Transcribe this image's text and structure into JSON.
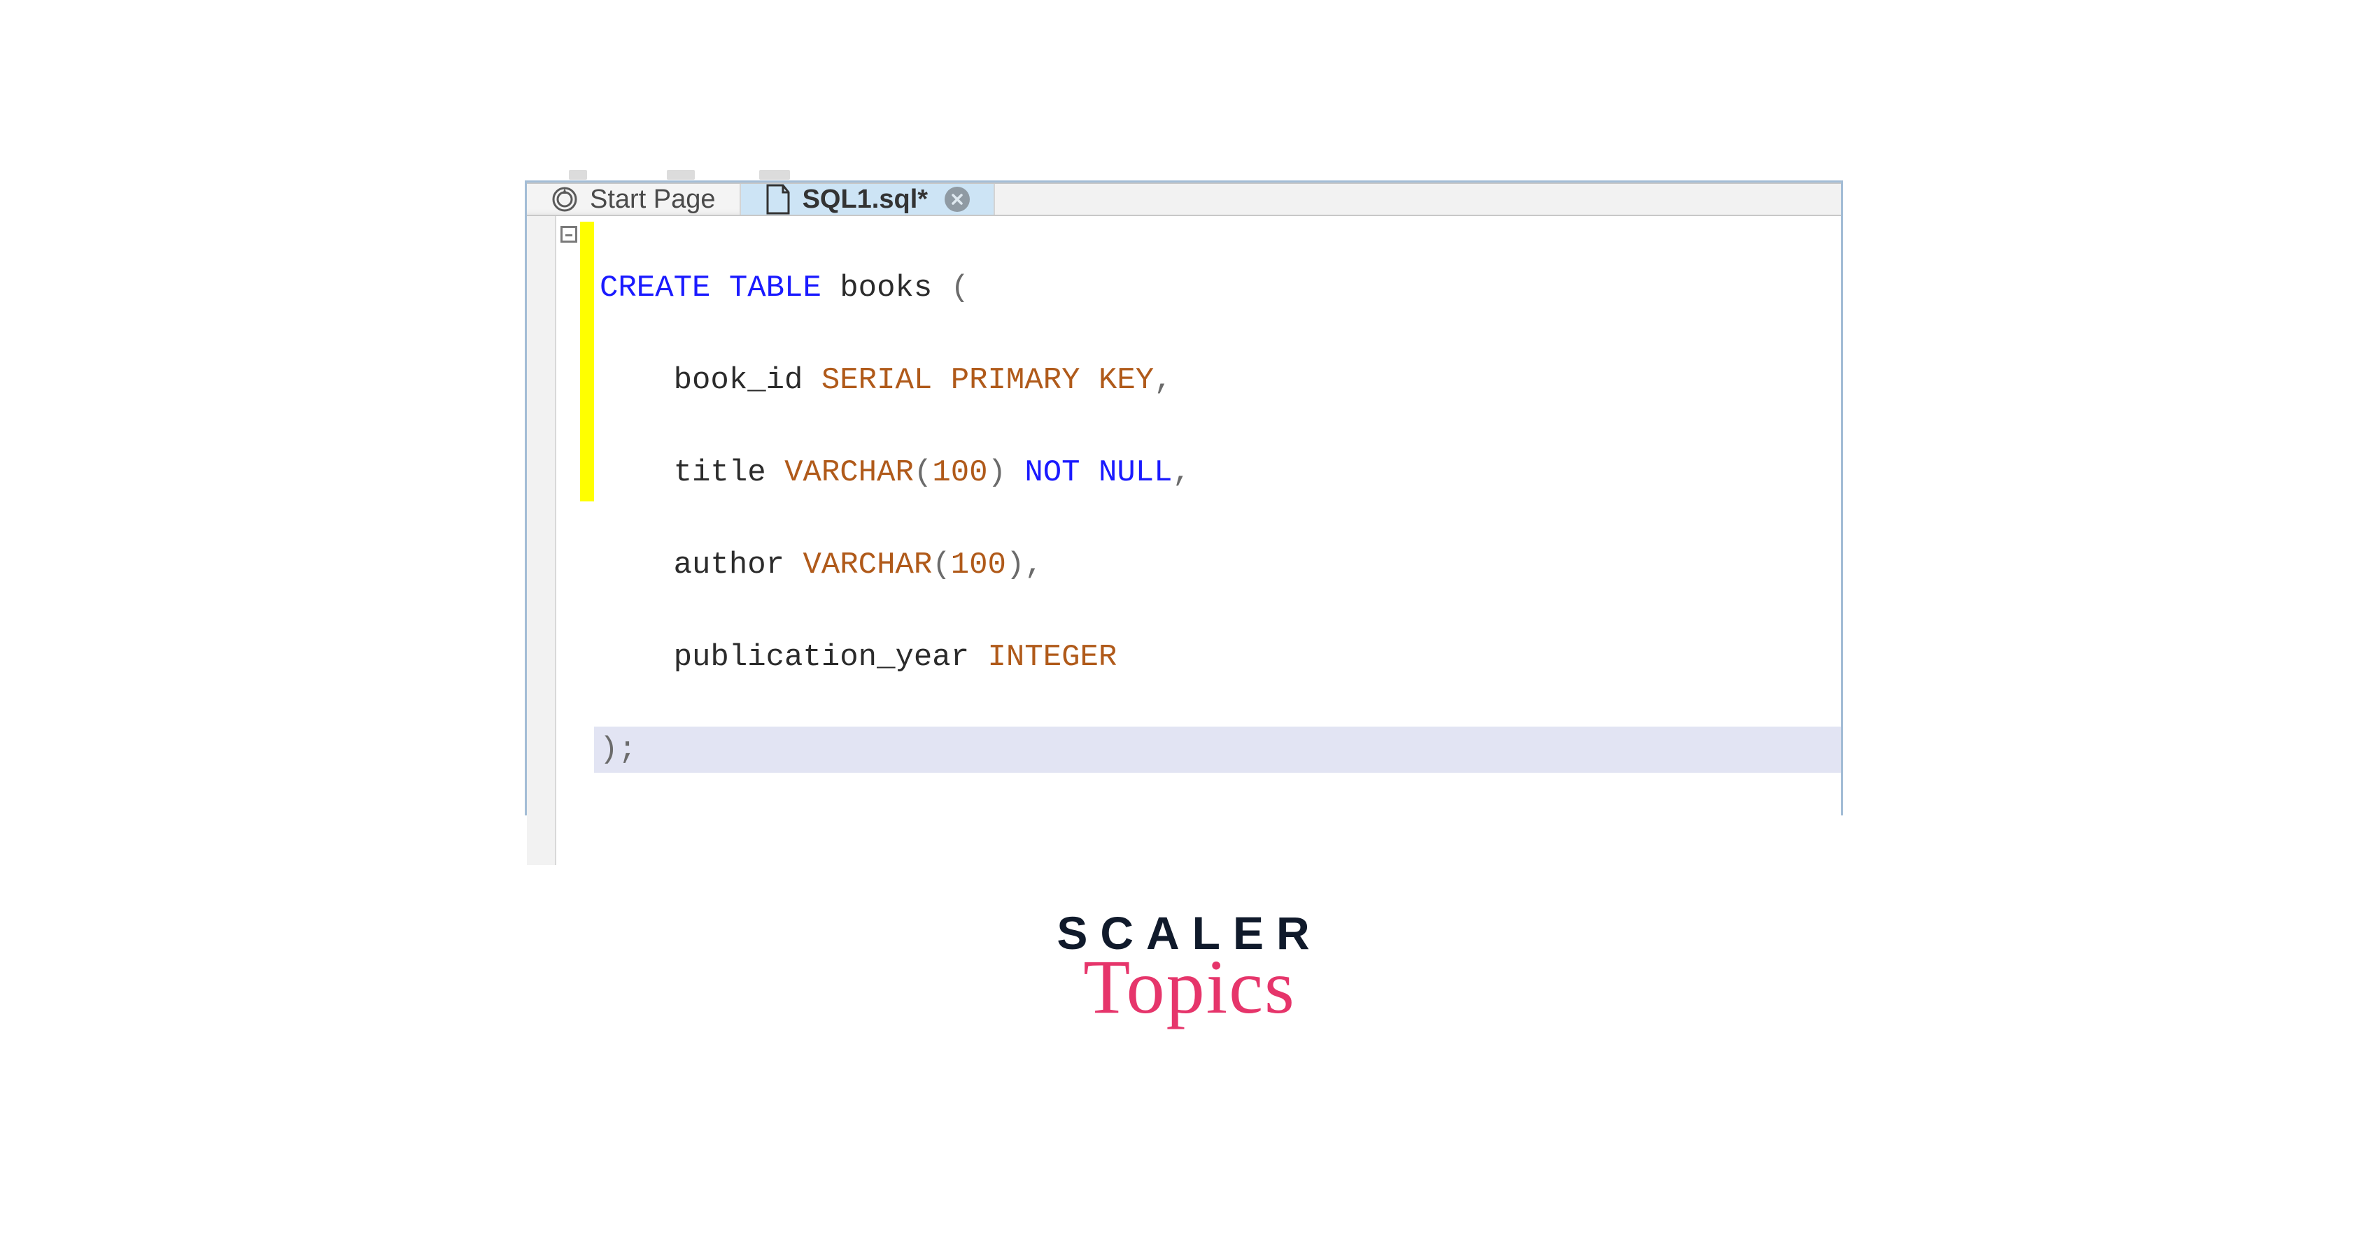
{
  "tabs": {
    "start": {
      "label": "Start Page"
    },
    "sql": {
      "label": "SQL1.sql*"
    }
  },
  "code": {
    "l1": {
      "kw1": "CREATE",
      "kw2": "TABLE",
      "name": "books",
      "open": "("
    },
    "l2": {
      "indent": "    ",
      "col": "book_id",
      "t1": "SERIAL",
      "t2": "PRIMARY",
      "t3": "KEY",
      "tail": ","
    },
    "l3": {
      "indent": "    ",
      "col": "title",
      "t1": "VARCHAR",
      "open": "(",
      "n": "100",
      "close": ")",
      "kw1": "NOT",
      "kw2": "NULL",
      "tail": ","
    },
    "l4": {
      "indent": "    ",
      "col": "author",
      "t1": "VARCHAR",
      "open": "(",
      "n": "100",
      "close": ")",
      "tail": ","
    },
    "l5": {
      "indent": "    ",
      "col": "publication_year",
      "t1": "INTEGER"
    },
    "l6": {
      "close": ")",
      "semi": ";"
    }
  },
  "brand": {
    "line1": "SCALER",
    "line2": "Topics"
  }
}
